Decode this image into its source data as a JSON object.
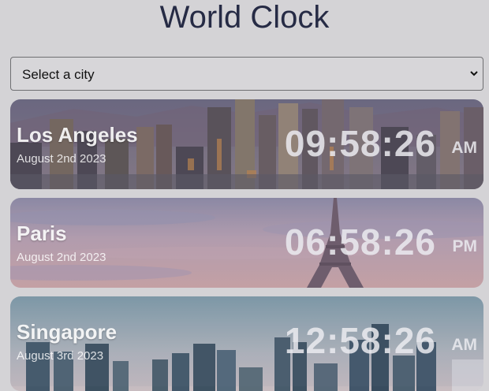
{
  "header": {
    "title": "World Clock"
  },
  "city_select": {
    "placeholder": "Select a city"
  },
  "clocks": [
    {
      "city": "Los Angeles",
      "date": "August 2nd 2023",
      "time": "09:58:26",
      "period": "AM"
    },
    {
      "city": "Paris",
      "date": "August 2nd 2023",
      "time": "06:58:26",
      "period": "PM"
    },
    {
      "city": "Singapore",
      "date": "August 3rd 2023",
      "time": "12:58:26",
      "period": "AM"
    }
  ],
  "colors": {
    "page_background": "#d4d3d6",
    "title": "#262b45"
  },
  "icons": {
    "select_arrow": "chevron-down-icon"
  }
}
